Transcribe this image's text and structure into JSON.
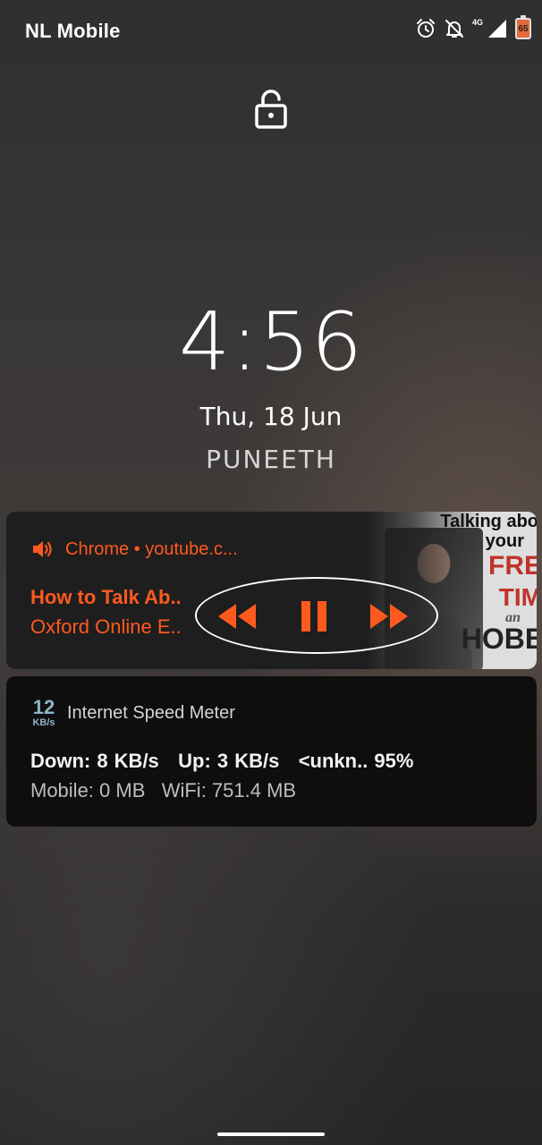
{
  "status_bar": {
    "carrier": "NL Mobile",
    "network_label": "4G",
    "battery_level": "65",
    "icons": [
      "alarm-icon",
      "notifications-off-icon",
      "signal-icon",
      "battery-icon"
    ]
  },
  "lockscreen": {
    "lock_icon": "lock-icon",
    "time": "4:56",
    "date": "Thu, 18 Jun",
    "owner": "PUNEETH"
  },
  "media_notification": {
    "source": "Chrome • youtube.c...",
    "title": "How to Talk Ab..",
    "artist": "Oxford Online E..",
    "accent_color": "#ff5a1e",
    "thumbnail_text": [
      "Talking abo",
      "your",
      "FRE",
      "TIM",
      "an",
      "HOBB"
    ],
    "controls": [
      "rewind-icon",
      "pause-icon",
      "fast-forward-icon"
    ]
  },
  "speed_notification": {
    "icon_value": "12",
    "icon_unit": "KB/s",
    "app_name": "Internet Speed Meter",
    "line1": "Down: 8 KB/s   Up: 3 KB/s   <unkn.. 95%",
    "line2": "Mobile: 0 MB   WiFi: 751.4 MB"
  }
}
